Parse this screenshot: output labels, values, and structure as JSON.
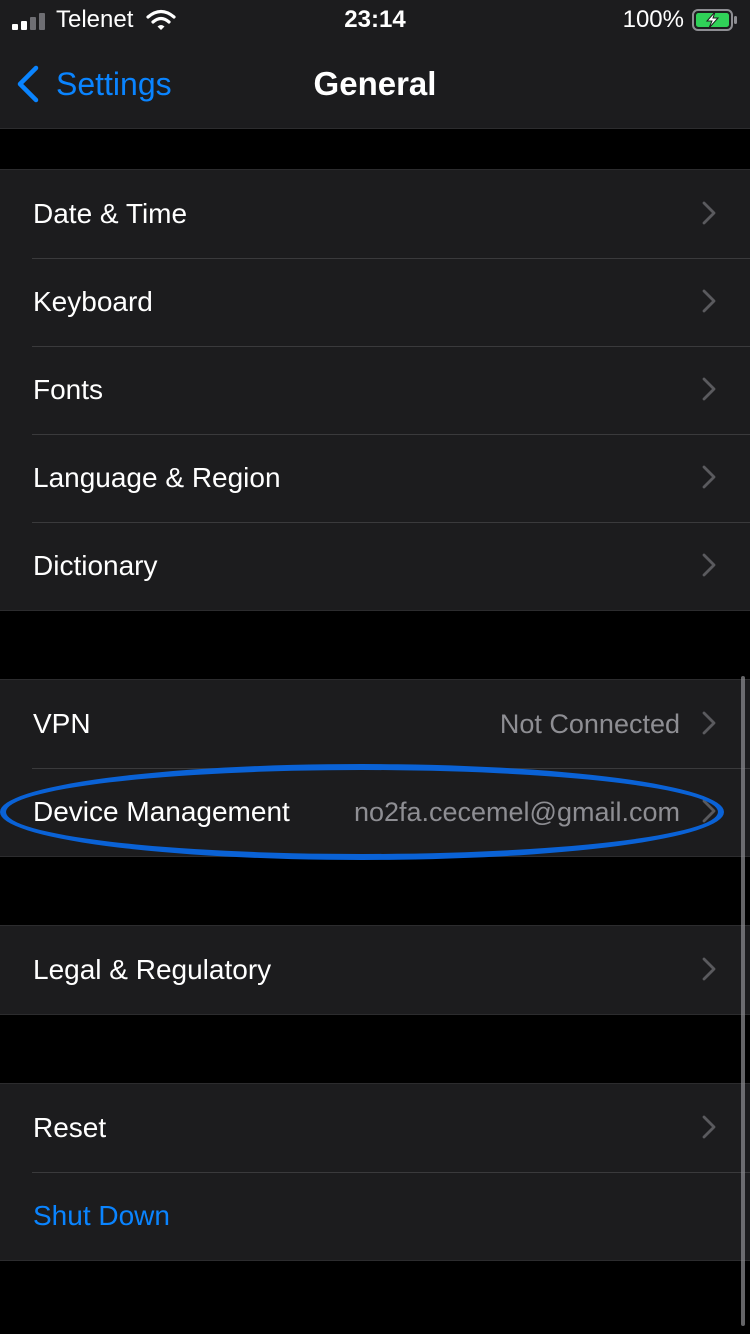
{
  "status_bar": {
    "carrier": "Telenet",
    "time": "23:14",
    "battery_percent": "100%",
    "signal_icon": "cellular-signal-icon",
    "wifi_icon": "wifi-icon",
    "battery_icon": "battery-charging-icon"
  },
  "nav": {
    "back_label": "Settings",
    "title": "General"
  },
  "groups": {
    "regional": [
      {
        "label": "Date & Time"
      },
      {
        "label": "Keyboard"
      },
      {
        "label": "Fonts"
      },
      {
        "label": "Language & Region"
      },
      {
        "label": "Dictionary"
      }
    ],
    "network": [
      {
        "label": "VPN",
        "value": "Not Connected"
      },
      {
        "label": "Device Management",
        "value": "no2fa.cecemel@gmail.com"
      }
    ],
    "legal": [
      {
        "label": "Legal & Regulatory"
      }
    ],
    "system": [
      {
        "label": "Reset"
      },
      {
        "label": "Shut Down"
      }
    ]
  },
  "colors": {
    "background": "#000000",
    "cell_background": "#1c1c1e",
    "accent": "#0a84ff",
    "secondary_text": "#8e8e93",
    "highlight_annotation": "#0a62d6",
    "battery_fill": "#30d158"
  }
}
